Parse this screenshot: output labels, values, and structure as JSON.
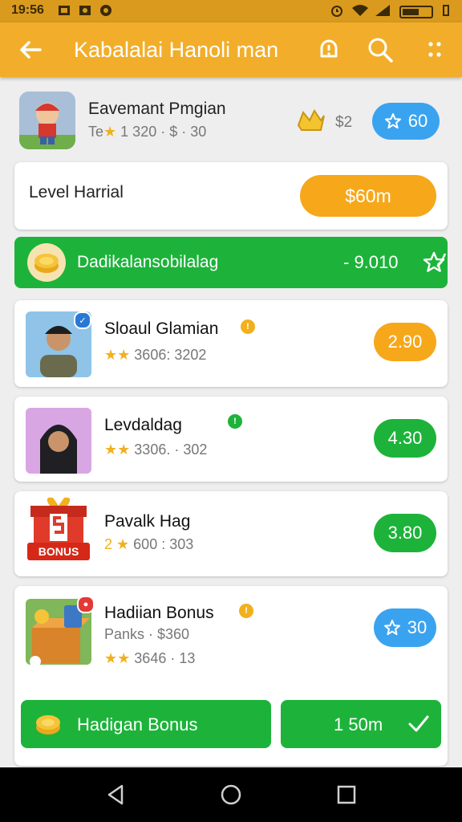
{
  "status_bar": {
    "time": "19:56"
  },
  "app_bar": {
    "title": "Kabalalai Hanoli man"
  },
  "header": {
    "title": "Eavemant Pmgian",
    "subtitle_prefix": "Te",
    "subtitle_rest": "1 320 · $ · 30",
    "price": "$2",
    "button_label": "60"
  },
  "level": {
    "label": "Level Harrial",
    "button_label": "$60m"
  },
  "banner": {
    "label": "Dadikalansobilalag",
    "value": "- 9.010"
  },
  "items": [
    {
      "name": "Sloaul Glamian",
      "stars": "★★",
      "meta": "3606: 3202",
      "button": "2.90",
      "color": "orange",
      "badge_color": "#f2b01e",
      "badge": "!"
    },
    {
      "name": "Levdaldag",
      "stars": "★★",
      "meta": "3306. · 302",
      "button": "4.30",
      "color": "green",
      "badge_color": "#1db33a",
      "badge": "!"
    },
    {
      "name": "Pavalk Hag",
      "stars": "2 ★",
      "meta": "600 : 303",
      "button": "3.80",
      "color": "green"
    },
    {
      "name": "Hadiian Bonus",
      "sub": "Panks · $360",
      "stars": "★★",
      "meta": "3646 · 13",
      "button": "30",
      "color": "blue",
      "badge_color": "#f2b01e",
      "badge": "!"
    }
  ],
  "bonus_thumb_text": "BONUS",
  "bottom": {
    "left_label": "Hadigan Bonus",
    "right_label": "1 50m"
  }
}
